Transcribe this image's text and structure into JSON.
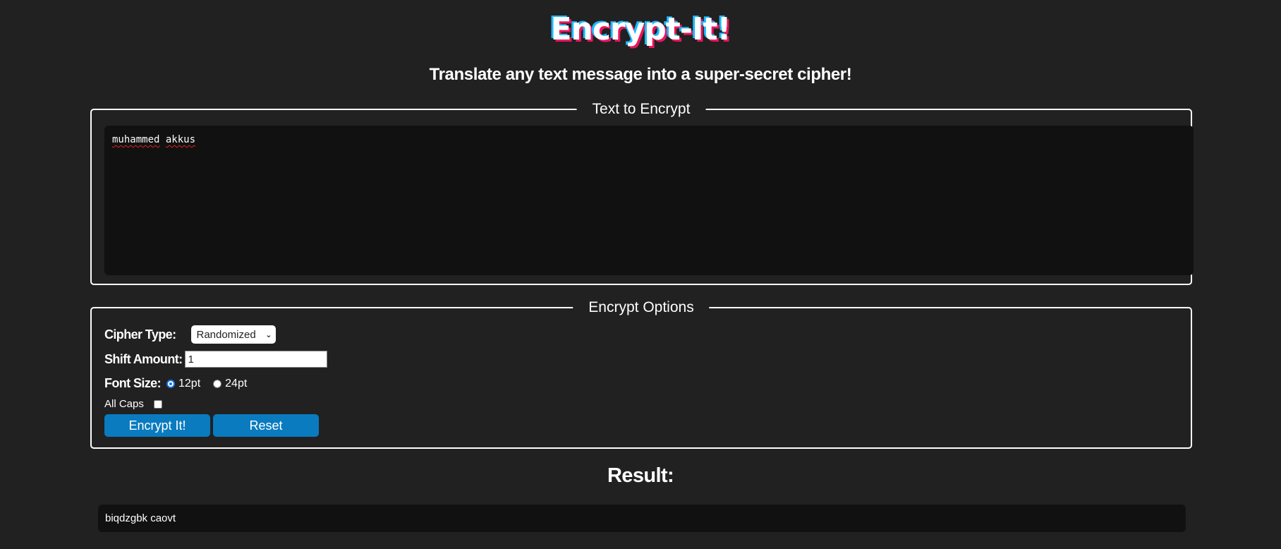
{
  "header": {
    "logo_text": "Encrypt-It!",
    "subtitle": "Translate any text message into a super-secret cipher!"
  },
  "text_section": {
    "legend": "Text to Encrypt",
    "words": [
      "muhammed",
      "akkus"
    ]
  },
  "options": {
    "legend": "Encrypt Options",
    "cipher_type_label": "Cipher Type:",
    "cipher_type_value": "Randomized",
    "shift_amount_label": "Shift Amount:",
    "shift_amount_value": "1",
    "font_size_label": "Font Size:",
    "font_size_options": [
      "12pt",
      "24pt"
    ],
    "font_size_selected": "12pt",
    "all_caps_label": "All Caps",
    "all_caps_checked": false,
    "encrypt_button": "Encrypt It!",
    "reset_button": "Reset"
  },
  "result": {
    "title": "Result:",
    "value": "biqdzgbk caovt"
  },
  "colors": {
    "background": "#212121",
    "panel": "#111111",
    "button": "#0a7bbf",
    "logo_shadow_blue": "#1fb8ff",
    "logo_shadow_pink": "#e8175d"
  }
}
